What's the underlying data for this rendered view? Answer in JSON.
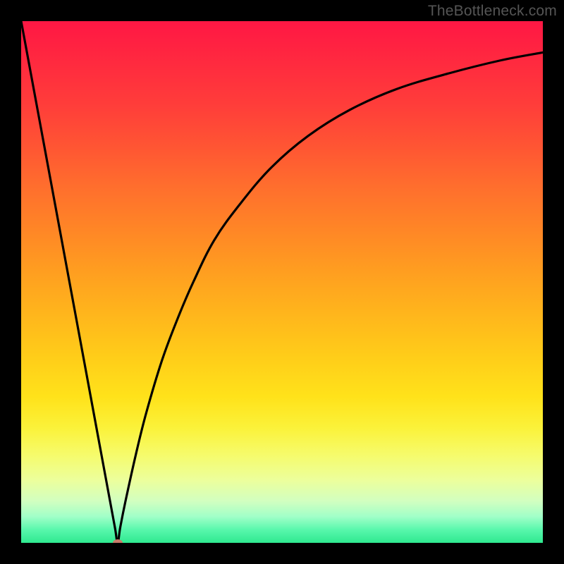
{
  "watermark": "TheBottleneck.com",
  "colors": {
    "background": "#000000",
    "curve": "#000000",
    "marker": "#c97b6a",
    "watermark": "#555555"
  },
  "chart_data": {
    "type": "line",
    "title": "",
    "xlabel": "",
    "ylabel": "",
    "xlim": [
      0,
      100
    ],
    "ylim": [
      0,
      100
    ],
    "annotations": [],
    "marker": {
      "x": 18.5,
      "y": 0
    },
    "series": [
      {
        "name": "bottleneck-curve",
        "x": [
          0,
          5,
          10,
          15,
          17,
          18,
          18.5,
          19,
          20,
          22,
          24,
          27,
          30,
          33,
          37,
          42,
          48,
          55,
          63,
          72,
          82,
          92,
          100
        ],
        "values": [
          100,
          73,
          46,
          19,
          8.2,
          2.8,
          0,
          3,
          8,
          17,
          25,
          35,
          43,
          50,
          58,
          65,
          72,
          78,
          83,
          87,
          90,
          92.5,
          94
        ]
      }
    ]
  }
}
